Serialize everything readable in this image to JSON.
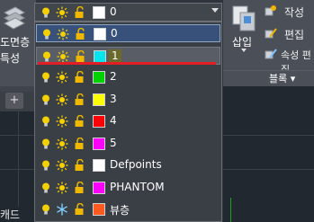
{
  "ribbon": {
    "left_labels": [
      "도면층",
      "특성"
    ],
    "right_items": [
      "작성",
      "편집",
      "속성 편집"
    ],
    "insert_label": "삽입",
    "block_panel_label": "블록",
    "block_panel_arrow": "▾"
  },
  "layer_combo": {
    "current_layer": "0",
    "current_color": "#ffffff"
  },
  "layers": [
    {
      "name": "0",
      "color": "#ffffff",
      "state": "selected",
      "frozen": false
    },
    {
      "name": "1",
      "color": "#00e5ee",
      "state": "hover",
      "frozen": false
    },
    {
      "name": "2",
      "color": "#00d100",
      "state": "normal",
      "frozen": false
    },
    {
      "name": "3",
      "color": "#ffff00",
      "state": "normal",
      "frozen": false
    },
    {
      "name": "4",
      "color": "#ff0000",
      "state": "normal",
      "frozen": false
    },
    {
      "name": "5",
      "color": "#ff00ff",
      "state": "normal",
      "frozen": false
    },
    {
      "name": "Defpoints",
      "color": "#ffffff",
      "state": "normal",
      "frozen": false
    },
    {
      "name": "PHANTOM",
      "color": "#ff00ff",
      "state": "normal",
      "frozen": false
    },
    {
      "name": "뷰층",
      "color": "#ff5a1f",
      "state": "normal",
      "frozen": true
    }
  ],
  "doc_tab_add": "+",
  "command_label": "캐드",
  "icons": {
    "on": "lightbulb-icon",
    "thaw": "sun-icon",
    "frozen": "snowflake-icon",
    "lock": "unlock-icon"
  },
  "colors": {
    "ribbon_bg": "#4b5058",
    "canvas_bg": "#222830",
    "selection": "#37517a",
    "annotation_red": "#e31e24"
  }
}
